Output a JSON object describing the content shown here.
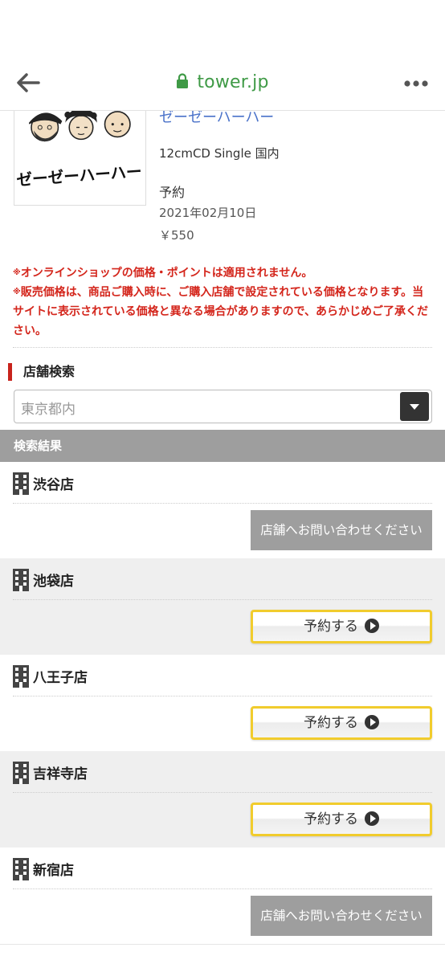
{
  "browser": {
    "url": "tower.jp",
    "icons": [
      "back-arrow-icon",
      "lock-icon",
      "more-dots-icon"
    ],
    "accent_color": "#3f9a46"
  },
  "product": {
    "artist": "ゼーゼーハーハー",
    "format": "12cmCD Single 国内",
    "status": "予約",
    "release_date": "2021年02月10日",
    "price": "￥550",
    "jacket_text": "ゼーゼーハーハー"
  },
  "notices": [
    "オンラインショップの価格・ポイントは適用されません。",
    "販売価格は、商品ご購入時に、ご購入店舗で設定されている価格となります。当サイトに表示されている価格と異なる場合がありますので、あらかじめご了承ください。"
  ],
  "notice_mark": "※",
  "store_search": {
    "title": "店舗検索",
    "selected_region": "東京都内"
  },
  "results": {
    "header": "検索結果",
    "stores": [
      {
        "name": "渋谷店",
        "action": "店舗へお問い合わせください",
        "type": "inquiry"
      },
      {
        "name": "池袋店",
        "action": "予約する",
        "type": "reserve"
      },
      {
        "name": "八王子店",
        "action": "予約する",
        "type": "reserve"
      },
      {
        "name": "吉祥寺店",
        "action": "予約する",
        "type": "reserve"
      },
      {
        "name": "新宿店",
        "action": "店舗へお問い合わせください",
        "type": "inquiry"
      }
    ]
  },
  "colors": {
    "notice_red": "#d4261c",
    "artist_link_blue": "#4a72c9",
    "reserve_border_yellow": "#f1cc2d",
    "section_bar_red": "#c8231c"
  }
}
